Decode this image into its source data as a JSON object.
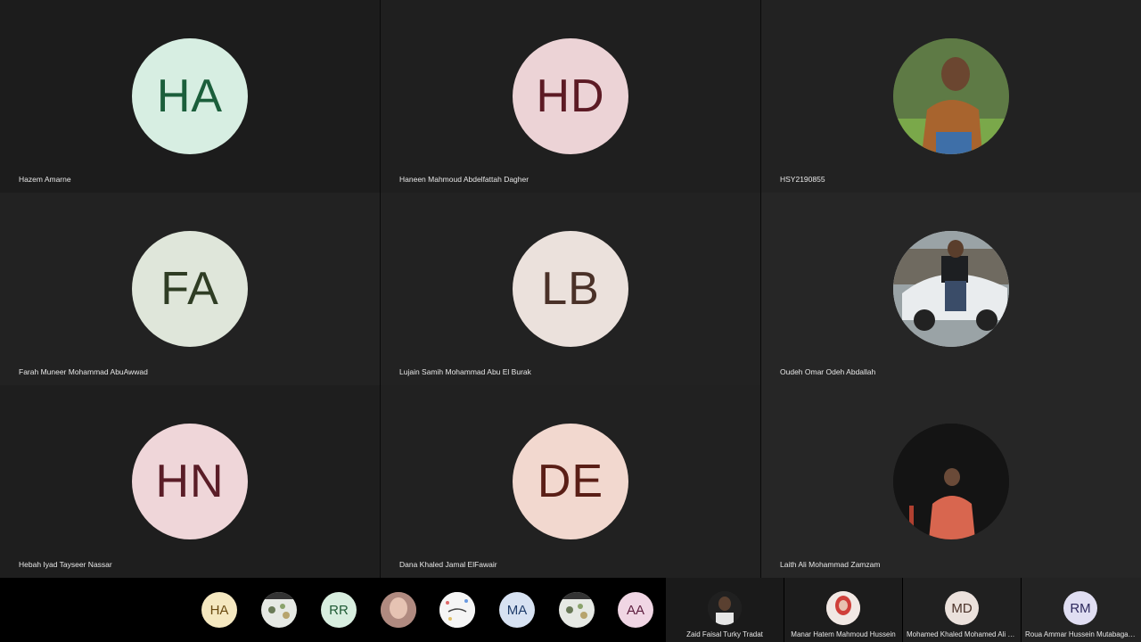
{
  "tiles": [
    {
      "initials": "HA",
      "name": "Hazem Amarne",
      "bg": "#d7eee2",
      "fg": "#1b5e3b",
      "photo": false
    },
    {
      "initials": "HD",
      "name": "Haneen Mahmoud Abdelfattah Dagher",
      "bg": "#ecd3d6",
      "fg": "#5c1a24",
      "photo": false
    },
    {
      "initials": "",
      "name": "HSY2190855",
      "photo": true
    },
    {
      "initials": "FA",
      "name": "Farah Muneer Mohammad AbuAwwad",
      "bg": "#dfe6da",
      "fg": "#2f3d24",
      "photo": false
    },
    {
      "initials": "LB",
      "name": "Lujain Samih Mohammad Abu El Burak",
      "bg": "#ebe1dc",
      "fg": "#4a3128",
      "photo": false
    },
    {
      "initials": "",
      "name": "Oudeh Omar Odeh Abdallah",
      "photo": true
    },
    {
      "initials": "HN",
      "name": "Hebah Iyad Tayseer Nassar",
      "bg": "#efd6d9",
      "fg": "#5a1d27",
      "photo": false
    },
    {
      "initials": "DE",
      "name": "Dana Khaled Jamal ElFawair",
      "bg": "#f2d8cf",
      "fg": "#5a1e16",
      "photo": false
    },
    {
      "initials": "",
      "name": "Laith Ali Mohammad Zamzam",
      "photo": true
    }
  ],
  "strip_avatars": [
    {
      "initials": "HA",
      "bg": "#f5e8c0",
      "fg": "#6a4a10"
    },
    {
      "initials": "",
      "bg": "#e6e9e4",
      "fg": "#333"
    },
    {
      "initials": "RR",
      "bg": "#d8eedf",
      "fg": "#1f5a35"
    },
    {
      "initials": "",
      "bg": "#c79a90",
      "fg": "#333"
    },
    {
      "initials": "",
      "bg": "#f2f2f2",
      "fg": "#333"
    },
    {
      "initials": "MA",
      "bg": "#d7e2f2",
      "fg": "#1e3c6a"
    },
    {
      "initials": "",
      "bg": "#e6e9e4",
      "fg": "#333"
    },
    {
      "initials": "AA",
      "bg": "#f0d6e4",
      "fg": "#5d1d3e"
    }
  ],
  "named_strip": [
    {
      "initials": "",
      "name": "Zaid Faisal Turky Tradat",
      "bg": "#2a2a2a",
      "fg": "#fff"
    },
    {
      "initials": "",
      "name": "Manar Hatem Mahmoud Hussein",
      "bg": "#d9b7b0",
      "fg": "#333"
    },
    {
      "initials": "MD",
      "name": "Mohamed Khaled Mohamed Ali Da...",
      "bg": "#ebe1dc",
      "fg": "#4a3128"
    },
    {
      "initials": "RM",
      "name": "Roua Ammar Hussein Mutabagani...",
      "bg": "#e0def2",
      "fg": "#2e2a5e"
    }
  ]
}
